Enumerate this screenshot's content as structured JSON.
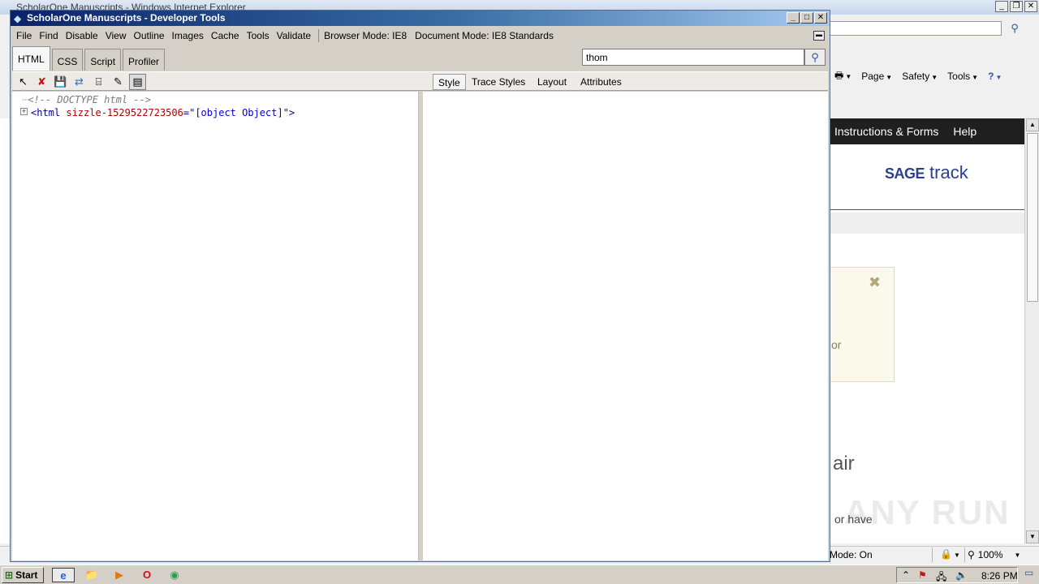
{
  "ie": {
    "title": "ScholarOne Manuscripts - Windows Internet Explorer",
    "toolbar": {
      "page": "Page",
      "safety": "Safety",
      "tools": "Tools"
    },
    "site": {
      "nav_instructions": "Instructions & Forms",
      "nav_help": "Help",
      "logo_sage": "SAGE",
      "logo_track": "track",
      "alert_fragment": "or",
      "heading_fragment": "air",
      "para_fragment": "or have"
    },
    "status": {
      "mode": "Mode: On",
      "zoom": "100%"
    },
    "watermark": "ANY RUN"
  },
  "devtools": {
    "title": "ScholarOne Manuscripts - Developer Tools",
    "menu": [
      "File",
      "Find",
      "Disable",
      "View",
      "Outline",
      "Images",
      "Cache",
      "Tools",
      "Validate"
    ],
    "browser_mode_label": "Browser Mode:",
    "browser_mode_value": "IE8",
    "document_mode_label": "Document Mode:",
    "document_mode_value": "IE8 Standards",
    "tabs": [
      "HTML",
      "CSS",
      "Script",
      "Profiler"
    ],
    "active_tab": "HTML",
    "search": {
      "value": "thom"
    },
    "pane_tabs": [
      "Style",
      "Trace Styles",
      "Layout",
      "Attributes"
    ],
    "active_pane_tab": "Style",
    "tree": {
      "doctype": "<!-- DOCTYPE html -->",
      "html_open": "<html",
      "html_attr_name": "sizzle-1529522723506",
      "html_attr_eq": "=",
      "html_attr_value": "\"[object Object]\"",
      "html_close": ">",
      "expand_glyph": "+"
    }
  },
  "taskbar": {
    "start": "Start",
    "clock": "8:26 PM"
  },
  "colors": {
    "devtools_titlebar": "#0a246a",
    "tag": "#00008b",
    "attr": "#b00000",
    "site_nav": "#1f1f1f",
    "sage_blue": "#2c3f8f"
  }
}
